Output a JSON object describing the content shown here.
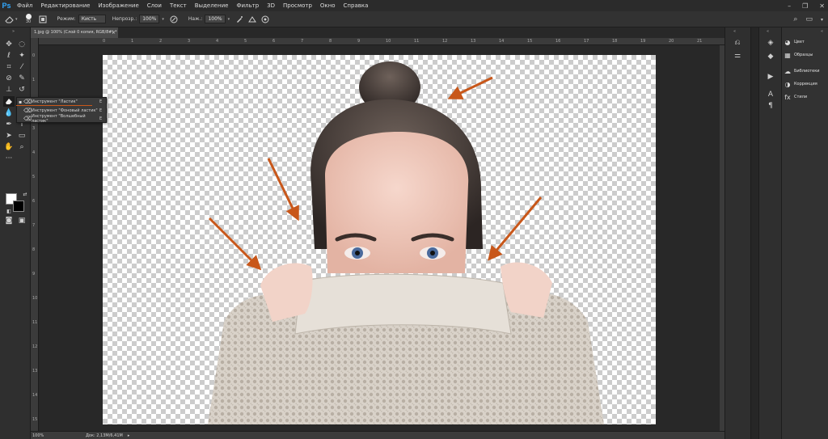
{
  "app": {
    "logo": "Ps"
  },
  "menu": [
    "Файл",
    "Редактирование",
    "Изображение",
    "Слои",
    "Текст",
    "Выделение",
    "Фильтр",
    "3D",
    "Просмотр",
    "Окно",
    "Справка"
  ],
  "window_controls": [
    "–",
    "❐",
    "✕"
  ],
  "options_bar": {
    "brush_size": "30",
    "mode_label": "Режим:",
    "mode_value": "Кисть",
    "opacity_label": "Непрозр.:",
    "opacity_value": "100%",
    "flow_label": "Наж.:",
    "flow_value": "100%"
  },
  "document": {
    "tab_title": "1.jpg @ 100% (Слой 0 копия, RGB/8#) *",
    "close": "×",
    "zoom": "100%",
    "doc_info": "Док: 2,13M/6,41M",
    "ruler_top": [
      "0",
      "1",
      "2",
      "3",
      "4",
      "5",
      "6",
      "7",
      "8",
      "9",
      "10",
      "11",
      "12",
      "13",
      "14",
      "15",
      "16",
      "17",
      "18",
      "19",
      "20",
      "21",
      "22",
      "23",
      "24"
    ],
    "ruler_left": [
      "0",
      "1",
      "2",
      "3",
      "4",
      "5",
      "6",
      "7",
      "8",
      "9",
      "10",
      "11",
      "12",
      "13",
      "14",
      "15",
      "16"
    ]
  },
  "flyout": {
    "items": [
      {
        "label": "Инструмент \"Ластик\"",
        "key": "E",
        "selected": true
      },
      {
        "label": "Инструмент \"Фоновый ластик\"",
        "key": "E",
        "selected": false
      },
      {
        "label": "Инструмент \"Волшебный ластик\"",
        "key": "E",
        "selected": false
      }
    ]
  },
  "colors": {
    "foreground": "#ffffff",
    "background": "#000000",
    "accent_arrow": "#c8571a"
  },
  "panels": [
    {
      "label": "Цвет",
      "icon": "color-wheel-icon"
    },
    {
      "label": "Образцы",
      "icon": "swatches-icon"
    },
    {
      "label": "Библиотеки",
      "icon": "libraries-icon"
    },
    {
      "label": "Коррекция",
      "icon": "adjustments-icon"
    },
    {
      "label": "Стили",
      "icon": "styles-icon"
    }
  ]
}
